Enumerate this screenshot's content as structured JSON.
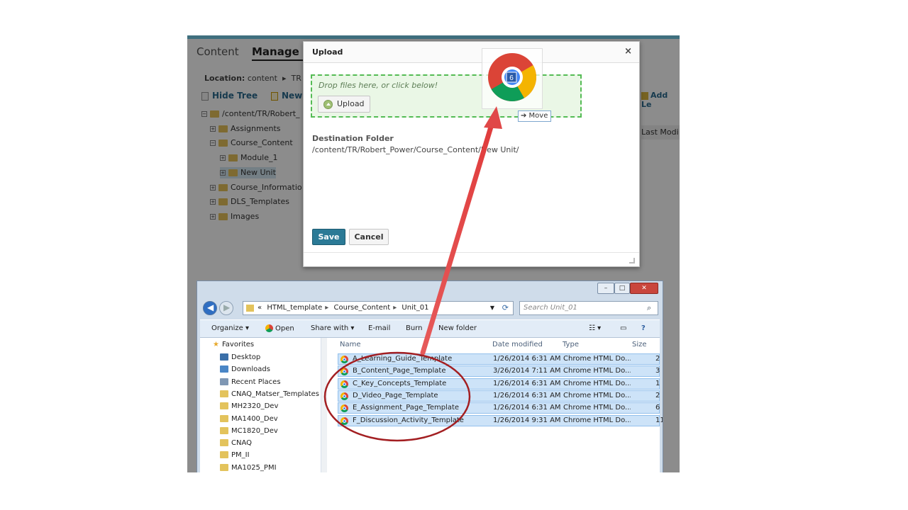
{
  "lms": {
    "tabs": [
      "Content",
      "Manage F"
    ],
    "location_label": "Location:",
    "location_path": "content",
    "location_tail": "TR",
    "hide_tree": "Hide Tree",
    "new_label": "New",
    "add_label": "Add Le",
    "last_modified": "Last Modi",
    "tree": [
      {
        "label": "/content/TR/Robert_",
        "sign": "−",
        "selected": false
      },
      {
        "label": "Assignments",
        "sign": "+",
        "selected": false
      },
      {
        "label": "Course_Content",
        "sign": "−",
        "selected": false
      },
      {
        "label": "Module_1",
        "sign": "+",
        "selected": false
      },
      {
        "label": "New Unit",
        "sign": "+",
        "selected": true
      },
      {
        "label": "Course_Informatio",
        "sign": "+",
        "selected": false
      },
      {
        "label": "DLS_Templates",
        "sign": "+",
        "selected": false
      },
      {
        "label": "Images",
        "sign": "+",
        "selected": false
      }
    ]
  },
  "dialog": {
    "title": "Upload",
    "close": "×",
    "drop_hint": "Drop files here, or click below!",
    "upload_button": "Upload",
    "destination_label": "Destination Folder",
    "destination_path": "/content/TR/Robert_Power/Course_Content/New Unit/",
    "save_button": "Save",
    "cancel_button": "Cancel"
  },
  "drag": {
    "badge": "6",
    "move_label": "➔ Move"
  },
  "explorer": {
    "window_buttons": [
      "–",
      "□",
      "✕"
    ],
    "breadcrumb": [
      "«",
      "HTML_template",
      "Course_Content",
      "Unit_01"
    ],
    "search_placeholder": "Search Unit_01",
    "toolbar": {
      "organize": "Organize ▾",
      "open": "Open",
      "share_with": "Share with ▾",
      "email": "E-mail",
      "burn": "Burn",
      "new_folder": "New folder"
    },
    "favorites_label": "Favorites",
    "nav_items": [
      {
        "label": "Desktop",
        "kind": "desk"
      },
      {
        "label": "Downloads",
        "kind": "dl"
      },
      {
        "label": "Recent Places",
        "kind": "rp"
      },
      {
        "label": "CNAQ_Matser_Templates",
        "kind": "folder"
      },
      {
        "label": "MH2320_Dev",
        "kind": "folder"
      },
      {
        "label": "MA1400_Dev",
        "kind": "folder"
      },
      {
        "label": "MC1820_Dev",
        "kind": "folder"
      },
      {
        "label": "CNAQ",
        "kind": "folder"
      },
      {
        "label": "PM_II",
        "kind": "folder"
      },
      {
        "label": "MA1025_PMI",
        "kind": "folder"
      }
    ],
    "columns": [
      "Name",
      "Date modified",
      "Type",
      "Size"
    ],
    "files": [
      {
        "name": "A_Learning_Guide_Template",
        "date": "1/26/2014 6:31 AM",
        "type": "Chrome HTML Do...",
        "size": "2"
      },
      {
        "name": "B_Content_Page_Template",
        "date": "3/26/2014 7:11 AM",
        "type": "Chrome HTML Do...",
        "size": "3"
      },
      {
        "name": "C_Key_Concepts_Template",
        "date": "1/26/2014 6:31 AM",
        "type": "Chrome HTML Do...",
        "size": "1"
      },
      {
        "name": "D_Video_Page_Template",
        "date": "1/26/2014 6:31 AM",
        "type": "Chrome HTML Do...",
        "size": "2"
      },
      {
        "name": "E_Assignment_Page_Template",
        "date": "1/26/2014 6:31 AM",
        "type": "Chrome HTML Do...",
        "size": "6"
      },
      {
        "name": "F_Discussion_Activity_Template",
        "date": "1/26/2014 9:31 AM",
        "type": "Chrome HTML Do...",
        "size": "11"
      }
    ]
  },
  "annotation_colors": {
    "arrow": "#e04848",
    "circle": "#a31f22"
  }
}
